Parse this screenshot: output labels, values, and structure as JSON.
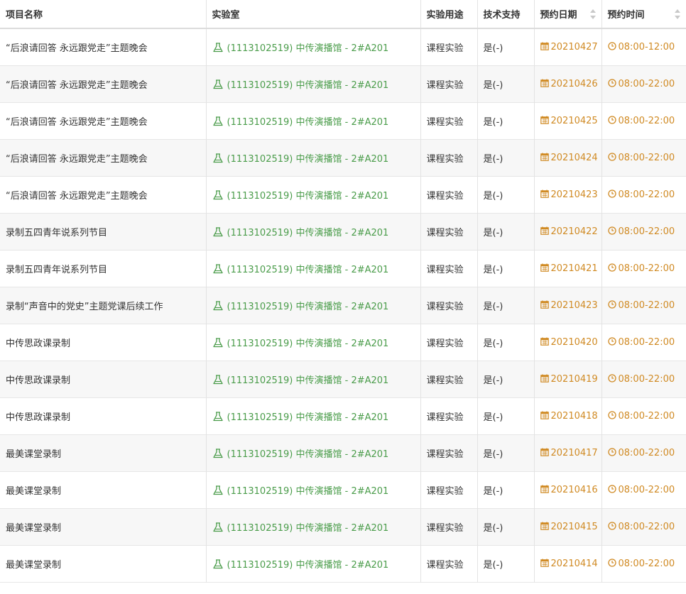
{
  "columns": {
    "project": "项目名称",
    "lab": "实验室",
    "usage": "实验用途",
    "tech_support": "技术支持",
    "date": "预约日期",
    "time": "预约时间"
  },
  "colors": {
    "lab_text": "#4a9c4a",
    "date_time_text": "#d08a23",
    "row_stripe": "#f7f7f7"
  },
  "icons": {
    "lab": "flask-icon",
    "date": "calendar-icon",
    "time": "clock-icon",
    "sort": "sort-icon"
  },
  "rows": [
    {
      "project": "“后浪请回答 永远跟党走”主题晚会",
      "lab": "(1113102519) 中传演播馆 - 2#A201",
      "usage": "课程实验",
      "tech": "是(-)",
      "date": "20210427",
      "time": "08:00-12:00"
    },
    {
      "project": "“后浪请回答 永远跟党走”主题晚会",
      "lab": "(1113102519) 中传演播馆 - 2#A201",
      "usage": "课程实验",
      "tech": "是(-)",
      "date": "20210426",
      "time": "08:00-22:00"
    },
    {
      "project": "“后浪请回答 永远跟党走”主题晚会",
      "lab": "(1113102519) 中传演播馆 - 2#A201",
      "usage": "课程实验",
      "tech": "是(-)",
      "date": "20210425",
      "time": "08:00-22:00"
    },
    {
      "project": "“后浪请回答 永远跟党走”主题晚会",
      "lab": "(1113102519) 中传演播馆 - 2#A201",
      "usage": "课程实验",
      "tech": "是(-)",
      "date": "20210424",
      "time": "08:00-22:00"
    },
    {
      "project": "“后浪请回答 永远跟党走”主题晚会",
      "lab": "(1113102519) 中传演播馆 - 2#A201",
      "usage": "课程实验",
      "tech": "是(-)",
      "date": "20210423",
      "time": "08:00-22:00"
    },
    {
      "project": "录制五四青年说系列节目",
      "lab": "(1113102519) 中传演播馆 - 2#A201",
      "usage": "课程实验",
      "tech": "是(-)",
      "date": "20210422",
      "time": "08:00-22:00"
    },
    {
      "project": "录制五四青年说系列节目",
      "lab": "(1113102519) 中传演播馆 - 2#A201",
      "usage": "课程实验",
      "tech": "是(-)",
      "date": "20210421",
      "time": "08:00-22:00"
    },
    {
      "project": "录制“声音中的党史”主题党课后续工作",
      "lab": "(1113102519) 中传演播馆 - 2#A201",
      "usage": "课程实验",
      "tech": "是(-)",
      "date": "20210423",
      "time": "08:00-22:00"
    },
    {
      "project": "中传思政课录制",
      "lab": "(1113102519) 中传演播馆 - 2#A201",
      "usage": "课程实验",
      "tech": "是(-)",
      "date": "20210420",
      "time": "08:00-22:00"
    },
    {
      "project": "中传思政课录制",
      "lab": "(1113102519) 中传演播馆 - 2#A201",
      "usage": "课程实验",
      "tech": "是(-)",
      "date": "20210419",
      "time": "08:00-22:00"
    },
    {
      "project": "中传思政课录制",
      "lab": "(1113102519) 中传演播馆 - 2#A201",
      "usage": "课程实验",
      "tech": "是(-)",
      "date": "20210418",
      "time": "08:00-22:00"
    },
    {
      "project": "最美课堂录制",
      "lab": "(1113102519) 中传演播馆 - 2#A201",
      "usage": "课程实验",
      "tech": "是(-)",
      "date": "20210417",
      "time": "08:00-22:00"
    },
    {
      "project": "最美课堂录制",
      "lab": "(1113102519) 中传演播馆 - 2#A201",
      "usage": "课程实验",
      "tech": "是(-)",
      "date": "20210416",
      "time": "08:00-22:00"
    },
    {
      "project": "最美课堂录制",
      "lab": "(1113102519) 中传演播馆 - 2#A201",
      "usage": "课程实验",
      "tech": "是(-)",
      "date": "20210415",
      "time": "08:00-22:00"
    },
    {
      "project": "最美课堂录制",
      "lab": "(1113102519) 中传演播馆 - 2#A201",
      "usage": "课程实验",
      "tech": "是(-)",
      "date": "20210414",
      "time": "08:00-22:00"
    }
  ]
}
